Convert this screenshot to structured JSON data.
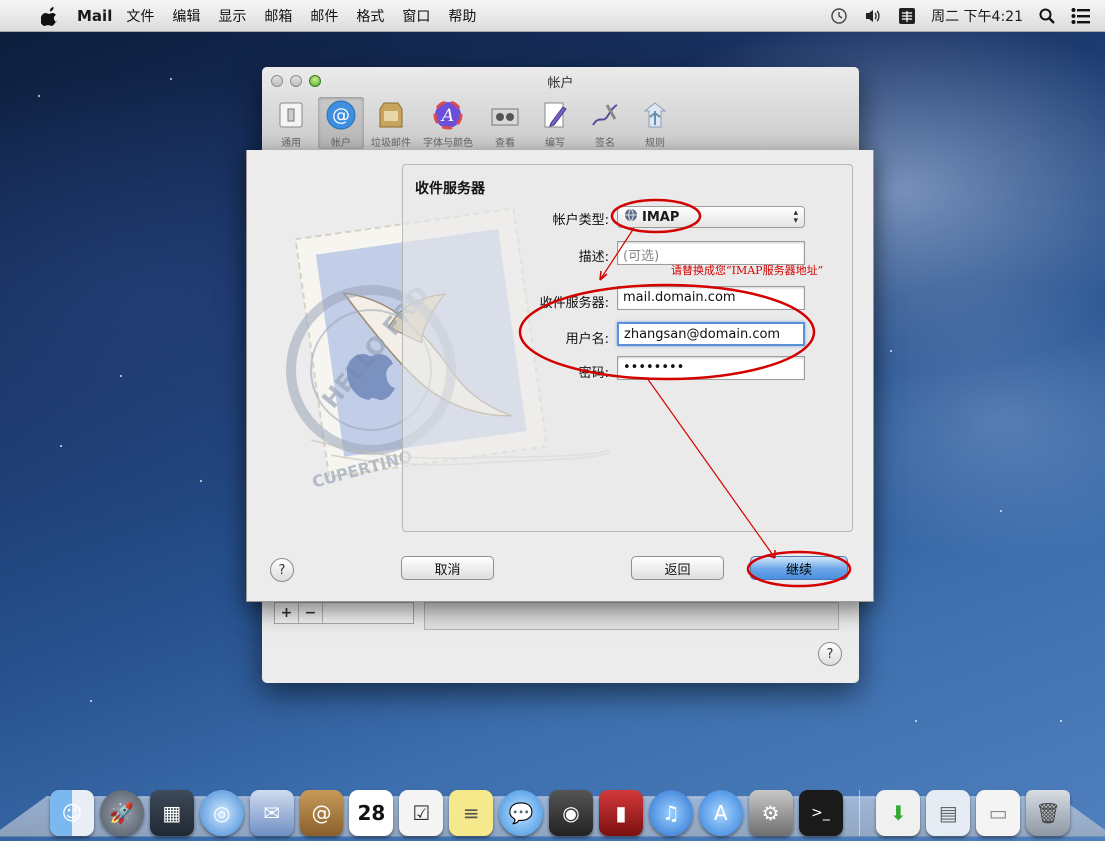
{
  "menubar": {
    "app_name": "Mail",
    "items": [
      "文件",
      "编辑",
      "显示",
      "邮箱",
      "邮件",
      "格式",
      "窗口",
      "帮助"
    ],
    "clock": "周二 下午4:21",
    "icons": [
      "apple-icon",
      "time-machine-icon",
      "volume-icon",
      "input-method-icon",
      "spotlight-icon",
      "notification-center-icon"
    ]
  },
  "prefs_window": {
    "title": "帐户",
    "toolbar": [
      {
        "label": "通用",
        "icon": "switch-icon"
      },
      {
        "label": "帐户",
        "icon": "at-icon"
      },
      {
        "label": "垃圾邮件",
        "icon": "junk-mail-icon"
      },
      {
        "label": "字体与颜色",
        "icon": "fonts-colors-icon"
      },
      {
        "label": "查看",
        "icon": "viewing-icon"
      },
      {
        "label": "编写",
        "icon": "composing-icon"
      },
      {
        "label": "签名",
        "icon": "signatures-icon"
      },
      {
        "label": "规则",
        "icon": "rules-icon"
      }
    ],
    "add_label": "+",
    "remove_label": "−",
    "help_label": "?"
  },
  "sheet": {
    "section_title": "收件服务器",
    "account_type_label": "帐户类型:",
    "account_type_value": "IMAP",
    "description_label": "描述:",
    "description_placeholder": "(可选)",
    "server_label": "收件服务器:",
    "server_value": "mail.domain.com",
    "username_label": "用户名:",
    "username_value": "zhangsan@domain.com",
    "password_label": "密码:",
    "password_value": "••••••••",
    "annotation": "请替换成您“IMAP服务器地址”",
    "help_label": "?",
    "cancel_label": "取消",
    "back_label": "返回",
    "continue_label": "继续",
    "annotation_color": "#d40000"
  },
  "dock": {
    "items": [
      "finder-icon",
      "launchpad-icon",
      "mission-control-icon",
      "safari-icon",
      "mail-icon",
      "contacts-icon",
      "calendar-icon",
      "reminders-icon",
      "notes-icon",
      "messages-icon",
      "facetime-icon",
      "photo-booth-icon",
      "itunes-icon",
      "app-store-icon",
      "system-preferences-icon",
      "terminal-icon",
      "downloads-icon",
      "documents-icon",
      "screenshot-icon",
      "trash-icon"
    ],
    "calendar_day": "28"
  }
}
